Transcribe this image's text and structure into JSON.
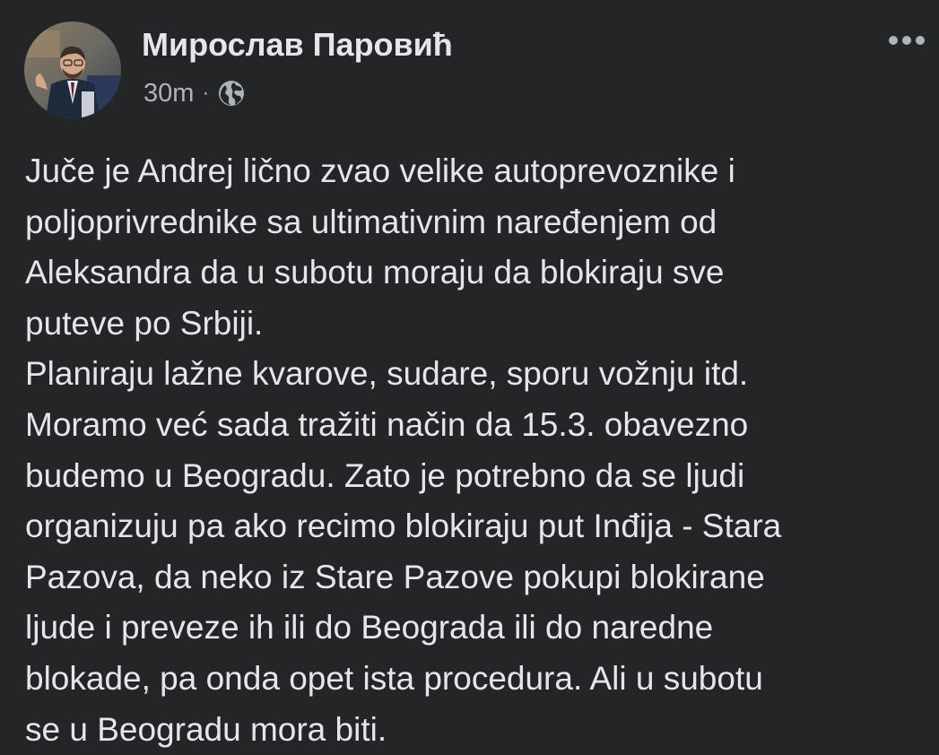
{
  "post": {
    "author": "Мирослав Паровић",
    "timestamp": "30m",
    "separator": "·",
    "audience_icon": "globe-icon",
    "more_icon": "more-options-icon",
    "lines": [
      "Juče je Andrej lično zvao velike autoprevoznike i",
      "poljoprivrednike sa ultimativnim naređenjem od",
      "Aleksandra da u subotu moraju da blokiraju sve",
      "puteve po Srbiji.",
      "Planiraju lažne kvarove, sudare, sporu vožnju itd.",
      "Moramo već sada tražiti način da 15.3. obavezno",
      "budemo u Beogradu. Zato je potrebno da se ljudi",
      "organizuju pa ako recimo blokiraju put Inđija - Stara",
      "Pazova, da neko iz Stare Pazove pokupi blokirane",
      "ljude i preveze ih ili do Beograda ili do naredne",
      "blokade, pa onda opet ista procedura. Ali u subotu",
      "se u Beogradu mora biti."
    ]
  },
  "colors": {
    "background": "#242526",
    "primary_text": "#e4e6eb",
    "secondary_text": "#b0b3b8"
  }
}
